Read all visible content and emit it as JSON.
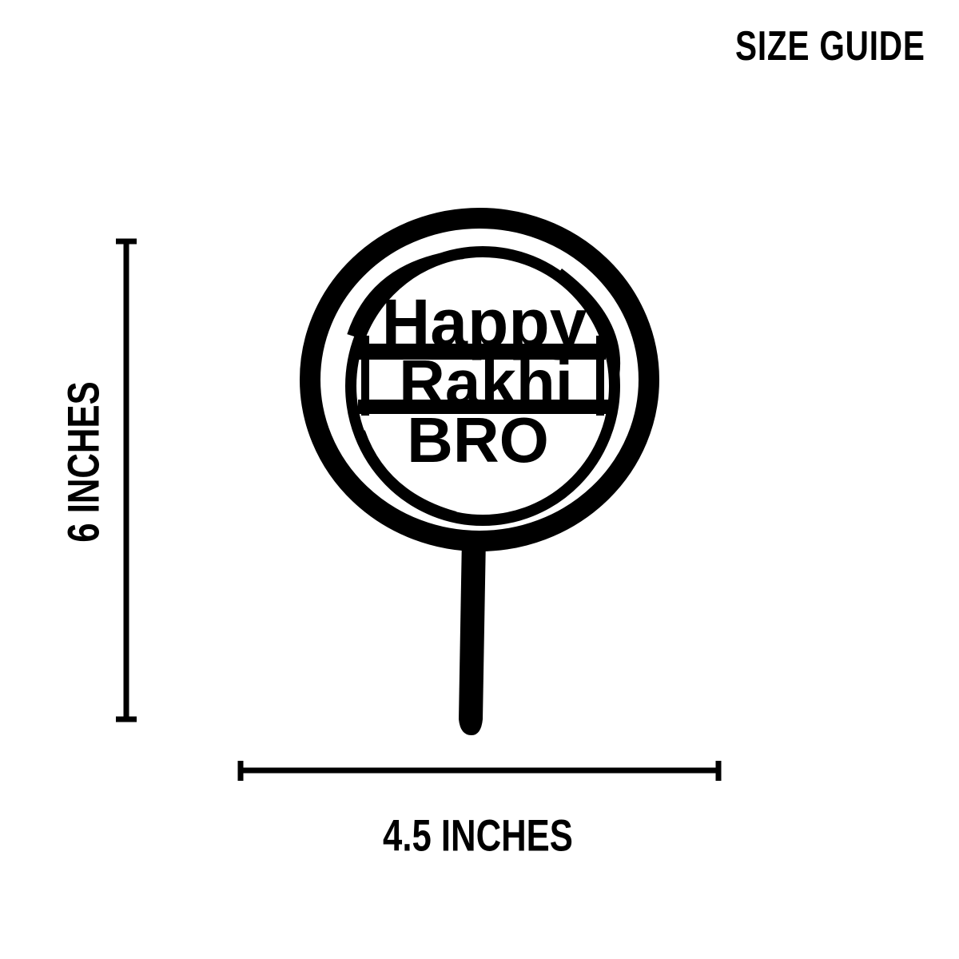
{
  "size_guide": {
    "title": "SIZE GUIDE",
    "height_label": "6 INCHES",
    "width_label": "4.5 INCHES"
  },
  "topper": {
    "line1": "Happy",
    "line2": "Rakhi",
    "line3": "BRO"
  },
  "colors": {
    "ink": "#000000",
    "background": "#ffffff"
  }
}
